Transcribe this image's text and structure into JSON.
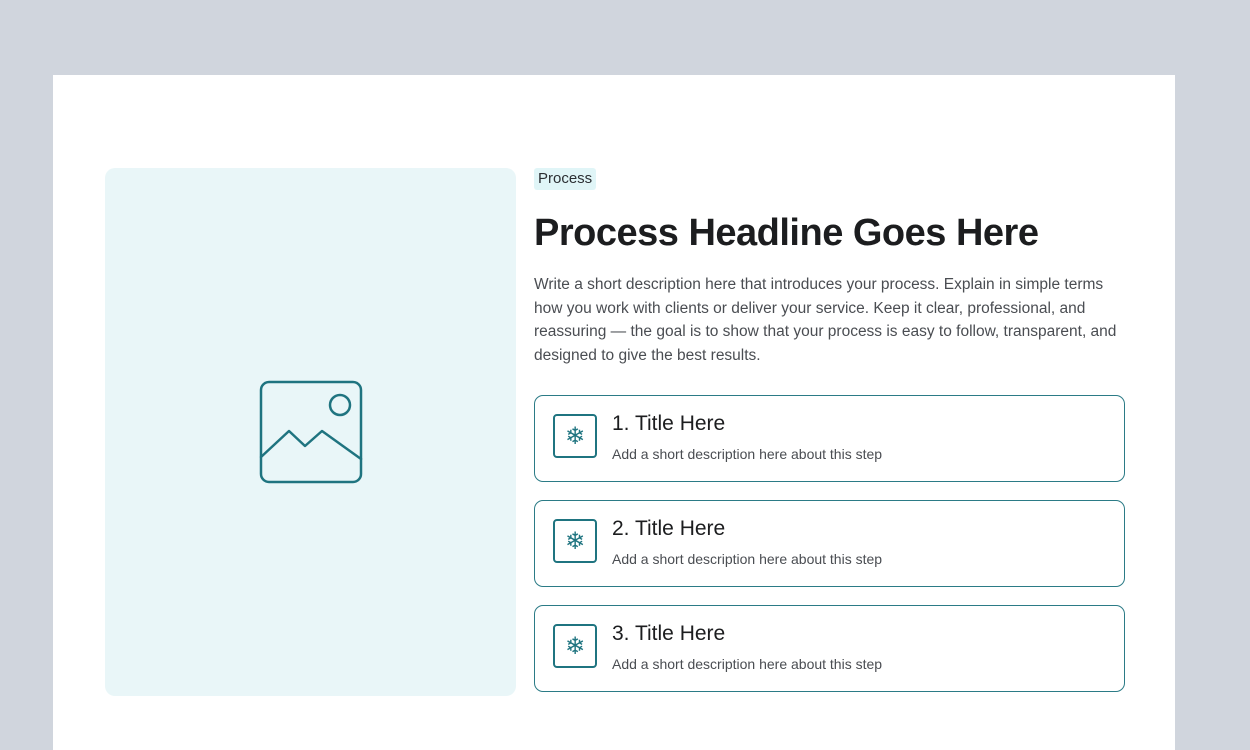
{
  "section": {
    "tag": "Process",
    "headline": "Process Headline Goes Here",
    "description": "Write a short description here that introduces your process. Explain in simple terms how you work with clients or deliver your service. Keep it clear, professional, and reassuring — the goal is to show that your process is easy to follow, transparent, and designed to give the best results."
  },
  "image_placeholder": {
    "icon": "image-placeholder-icon"
  },
  "steps": [
    {
      "icon": "snowflake-icon",
      "glyph": "❄",
      "title": "1. Title Here",
      "description": "Add a short description here about this step"
    },
    {
      "icon": "snowflake-icon",
      "glyph": "❄",
      "title": "2. Title Here",
      "description": "Add a short description here about this step"
    },
    {
      "icon": "snowflake-icon",
      "glyph": "❄",
      "title": "3. Title Here",
      "description": "Add a short description here about this step"
    }
  ],
  "colors": {
    "page_background": "#d0d5dd",
    "card_background": "#ffffff",
    "image_panel": "#e9f6f8",
    "accent": "#1f7480",
    "tag_background": "#e0f5f7",
    "headline": "#1c1d1f",
    "body_text": "#4a4d52"
  }
}
